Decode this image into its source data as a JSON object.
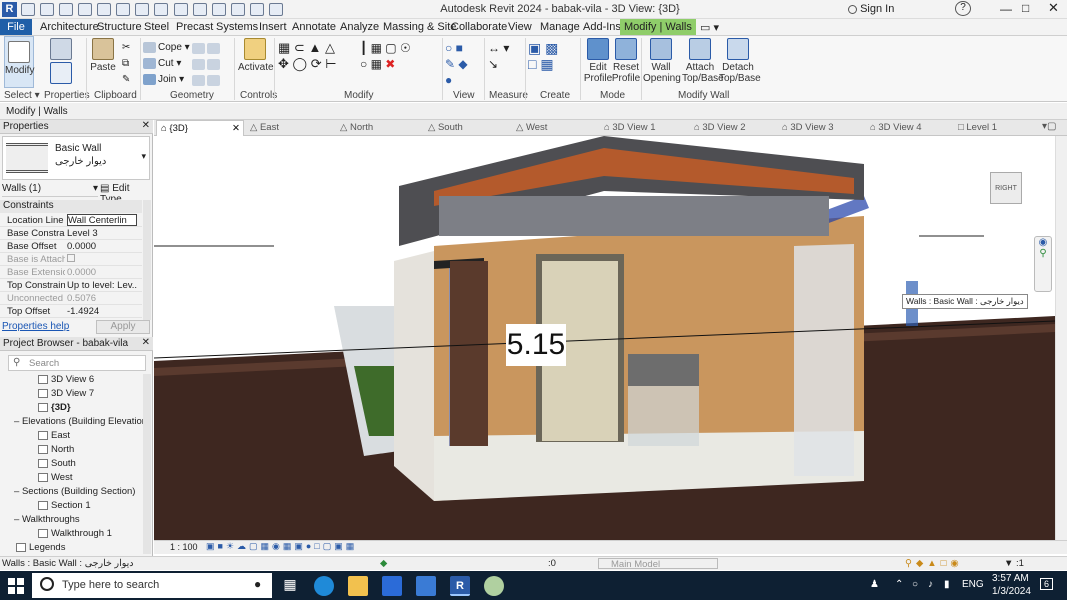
{
  "titlebar": {
    "title": "Autodesk Revit 2024 - babak-vila - 3D View: {3D}",
    "sign_in": "Sign In",
    "help": "?",
    "app_icon_letter": "R"
  },
  "menu": {
    "items": [
      "File",
      "Architecture",
      "Structure",
      "Steel",
      "Precast",
      "Systems",
      "Insert",
      "Annotate",
      "Analyze",
      "Massing & Site",
      "Collaborate",
      "View",
      "Manage",
      "Add-Ins",
      "Modify | Walls"
    ],
    "active": "Modify | Walls"
  },
  "ribbon": {
    "modify": "Modify",
    "paste": "Paste",
    "cope": "Cope",
    "cut": "Cut",
    "join": "Join",
    "activate": "Activate",
    "edit_profile": "Edit Profile",
    "reset_profile": "Reset Profile",
    "wall_opening": "Wall Opening",
    "attach_top_base": "Attach Top/Base",
    "detach_top_base": "Detach Top/Base",
    "panels": [
      "Select",
      "Properties",
      "Clipboard",
      "Geometry",
      "Controls",
      "Modify",
      "View",
      "Measure",
      "Create",
      "Mode",
      "Modify Wall"
    ]
  },
  "option_bar": {
    "context": "Modify | Walls"
  },
  "properties": {
    "header": "Properties",
    "type_name": "Basic Wall",
    "type_sub": "دیوار خارجی",
    "selector": "Walls (1)",
    "edit_type": "Edit Type",
    "section": "Constraints",
    "rows": [
      {
        "k": "Location Line",
        "v": "Wall Centerlin"
      },
      {
        "k": "Base Constraint",
        "v": "Level 3"
      },
      {
        "k": "Base Offset",
        "v": "0.0000"
      },
      {
        "k": "Base is Attach...",
        "v": ""
      },
      {
        "k": "Base Extensio...",
        "v": "0.0000"
      },
      {
        "k": "Top Constraint",
        "v": "Up to level: Lev..."
      },
      {
        "k": "Unconnected ...",
        "v": "0.5076"
      },
      {
        "k": "Top Offset",
        "v": "-1.4924"
      }
    ],
    "help": "Properties help",
    "apply": "Apply"
  },
  "browser": {
    "header": "Project Browser - babak-vila",
    "search_placeholder": "Search",
    "items": [
      {
        "label": "3D View 6",
        "level": 3
      },
      {
        "label": "3D View 7",
        "level": 3
      },
      {
        "label": "{3D}",
        "level": 3,
        "bold": true
      },
      {
        "label": "Elevations (Building Elevation)",
        "level": 1
      },
      {
        "label": "East",
        "level": 3
      },
      {
        "label": "North",
        "level": 3
      },
      {
        "label": "South",
        "level": 3
      },
      {
        "label": "West",
        "level": 3
      },
      {
        "label": "Sections (Building Section)",
        "level": 1
      },
      {
        "label": "Section 1",
        "level": 3
      },
      {
        "label": "Walkthroughs",
        "level": 1
      },
      {
        "label": "Walkthrough 1",
        "level": 3
      },
      {
        "label": "Legends",
        "level": 0
      }
    ]
  },
  "tabs": [
    "{3D}",
    "East",
    "North",
    "South",
    "West",
    "3D View 1",
    "3D View 2",
    "3D View 3",
    "3D View 4",
    "Level 1"
  ],
  "viewport": {
    "dimension": "5.15",
    "tooltip": "Walls : Basic Wall : دیوار خارجی",
    "viewcube": "RIGHT"
  },
  "view_strip": {
    "scale": "1 : 100"
  },
  "status": {
    "text": "Walls : Basic Wall : دیوار خارجی",
    "model": "Main Model",
    "workset": ":0",
    "filter": ":1"
  },
  "taskbar": {
    "search_placeholder": "Type here to search",
    "lang": "ENG",
    "time": "3:57 AM",
    "date": "1/3/2024",
    "notif": "6"
  }
}
